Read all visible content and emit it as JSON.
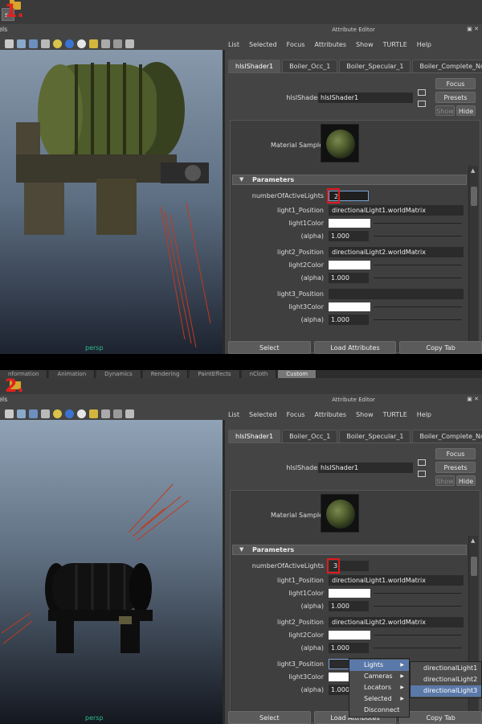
{
  "steps": [
    {
      "label": "1"
    },
    {
      "label": "2"
    }
  ],
  "shelf": {
    "tabs": [
      "nformation",
      "Animation",
      "Dynamics",
      "Rendering",
      "PaintEffects",
      "nCloth",
      "Custom"
    ],
    "active_tab": "Custom",
    "visible_button_label": "s"
  },
  "viewport": {
    "panels_menu": "els",
    "camera_label": "persp"
  },
  "attribute_editor": {
    "title": "Attribute Editor",
    "menu": [
      "List",
      "Selected",
      "Focus",
      "Attributes",
      "Show",
      "TURTLE",
      "Help"
    ],
    "tabs": [
      "hlslShader1",
      "Boiler_Occ_1",
      "Boiler_Specular_1",
      "Boiler_Complete_Norr"
    ],
    "shader_label": "hlslShader:",
    "shader_name": "hlslShader1",
    "buttons": {
      "focus": "Focus",
      "presets": "Presets",
      "show": "Show",
      "hide": "Hide"
    },
    "material_sample_label": "Material Sample",
    "parameters_header": "Parameters",
    "bottom_buttons": [
      "Select",
      "Load Attributes",
      "Copy Tab"
    ]
  },
  "params_step1": {
    "numberOfActiveLights_label": "numberOfActiveLights",
    "numberOfActiveLights": "2",
    "light1_position_label": "light1_Position",
    "light1_position": "directionalLight1.worldMatrix",
    "light1_color_label": "light1Color",
    "alpha_label": "(alpha)",
    "light1_alpha": "1.000",
    "light2_position_label": "light2_Position",
    "light2_position": "directionalLight2.worldMatrix",
    "light2_color_label": "light2Color",
    "light2_alpha": "1.000",
    "light3_position_label": "light3_Position",
    "light3_position": "",
    "light3_color_label": "light3Color",
    "light3_alpha": "1.000"
  },
  "params_step2": {
    "numberOfActiveLights_label": "numberOfActiveLights",
    "numberOfActiveLights": "3",
    "light1_position_label": "light1_Position",
    "light1_position": "directionalLight1.worldMatrix",
    "light1_color_label": "light1Color",
    "alpha_label": "(alpha)",
    "light1_alpha": "1.000",
    "light2_position_label": "light2_Position",
    "light2_position": "directionalLight2.worldMatrix",
    "light2_color_label": "light2Color",
    "light2_alpha": "1.000",
    "light3_position_label": "light3_Position",
    "light3_position": "",
    "light3_color_label": "light3Color",
    "light3_alpha": "1.000"
  },
  "context_menu": {
    "items": [
      "Lights",
      "Cameras",
      "Locators",
      "Selected",
      "Disconnect"
    ],
    "active": "Lights",
    "submenu": [
      "directionalLight1",
      "directionalLight2",
      "directionalLight3"
    ],
    "submenu_active": "directionalLight3"
  },
  "colors": {
    "highlight_red": "#e01b1b",
    "menu_active": "#5a78a8",
    "light_color": "#ffffff"
  }
}
